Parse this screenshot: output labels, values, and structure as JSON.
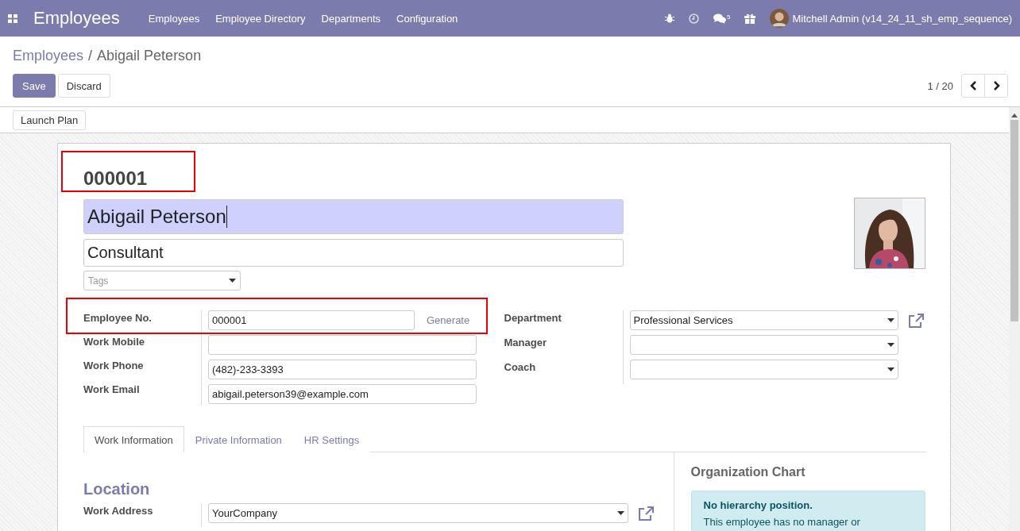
{
  "navbar": {
    "app_title": "Employees",
    "menu": [
      "Employees",
      "Employee Directory",
      "Departments",
      "Configuration"
    ],
    "messages_count": "5",
    "user": "Mitchell Admin (v14_24_11_sh_emp_sequence)"
  },
  "breadcrumb": {
    "separator": "/",
    "items": [
      {
        "label": "Employees",
        "link": true
      },
      {
        "label": "Abigail Peterson",
        "link": false
      }
    ]
  },
  "buttons": [
    {
      "label": "Save",
      "kind": "primary"
    },
    {
      "label": "Discard",
      "kind": "secondary"
    }
  ],
  "pager": "1 / 20",
  "header_buttons": [
    "Launch Plan"
  ],
  "employee": {
    "number": "000001",
    "name": "Abigail Peterson",
    "job_title": "Consultant",
    "tags": {
      "placeholder": "Tags"
    }
  },
  "fields_left": [
    {
      "label": "Employee No.",
      "value": "000001",
      "action": "Generate"
    },
    {
      "label": "Work Mobile"
    },
    {
      "label": "Work Phone",
      "value": "(482)-233-3393"
    },
    {
      "label": "Work Email",
      "value": "abigail.peterson39@example.com"
    }
  ],
  "fields_right": [
    {
      "label": "Department",
      "value": "Professional Services",
      "kind": "select",
      "external_link": true
    },
    {
      "label": "Manager",
      "kind": "select",
      "external_link": false
    },
    {
      "label": "Coach",
      "kind": "select",
      "external_link": false
    }
  ],
  "tabs": [
    {
      "label": "Work Information",
      "selected": true
    },
    {
      "label": "Private Information",
      "selected": false
    },
    {
      "label": "HR Settings",
      "selected": false
    }
  ],
  "location": {
    "title": "Location",
    "fields": [
      {
        "label": "Work Address",
        "value": "YourCompany",
        "kind": "select",
        "external_link": true
      }
    ]
  },
  "org_chart": {
    "title": "Organization Chart",
    "alert_title": "No hierarchy position.",
    "alert_text": "This employee has no manager or"
  }
}
